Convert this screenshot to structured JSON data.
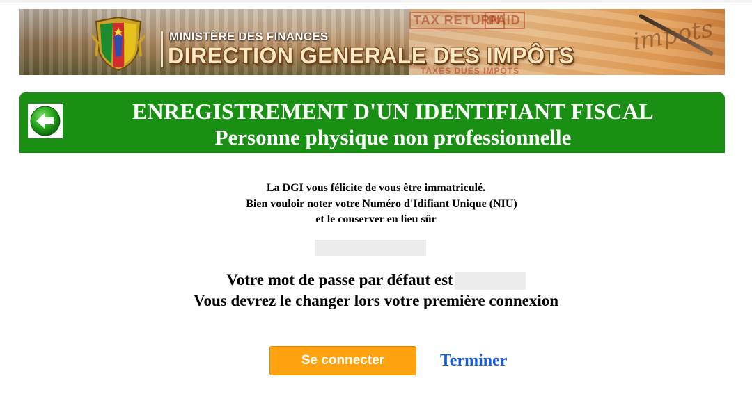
{
  "banner": {
    "ministry": "MINISTÈRE DES FINANCES",
    "direction": "DIRECTION GENERALE DES IMPÔTS",
    "stamp_tax_return": "TAX RETURN",
    "stamp_paid": "PAID",
    "stamp_taxes": "TAXES DUES IMPOTS",
    "script_text": "impots"
  },
  "header": {
    "back_icon": "arrow-left-icon",
    "title": "ENREGISTREMENT D'UN IDENTIFIANT FISCAL",
    "subtitle": "Personne physique non professionnelle"
  },
  "message": {
    "line1": "La DGI vous félicite de vous être immatriculé.",
    "line2": "Bien vouloir noter votre Numéro d'Idifiant Unique (NIU)",
    "line3": "et le conserver en lieu sûr",
    "password_prefix": "Votre mot de passe par défaut est",
    "password_note": "Vous devrez le changer lors votre première connexion"
  },
  "actions": {
    "connect_label": "Se connecter",
    "finish_label": "Terminer"
  },
  "colors": {
    "title_green": "#199013",
    "connect_orange": "#fea30f",
    "link_blue": "#1a5fd6"
  }
}
